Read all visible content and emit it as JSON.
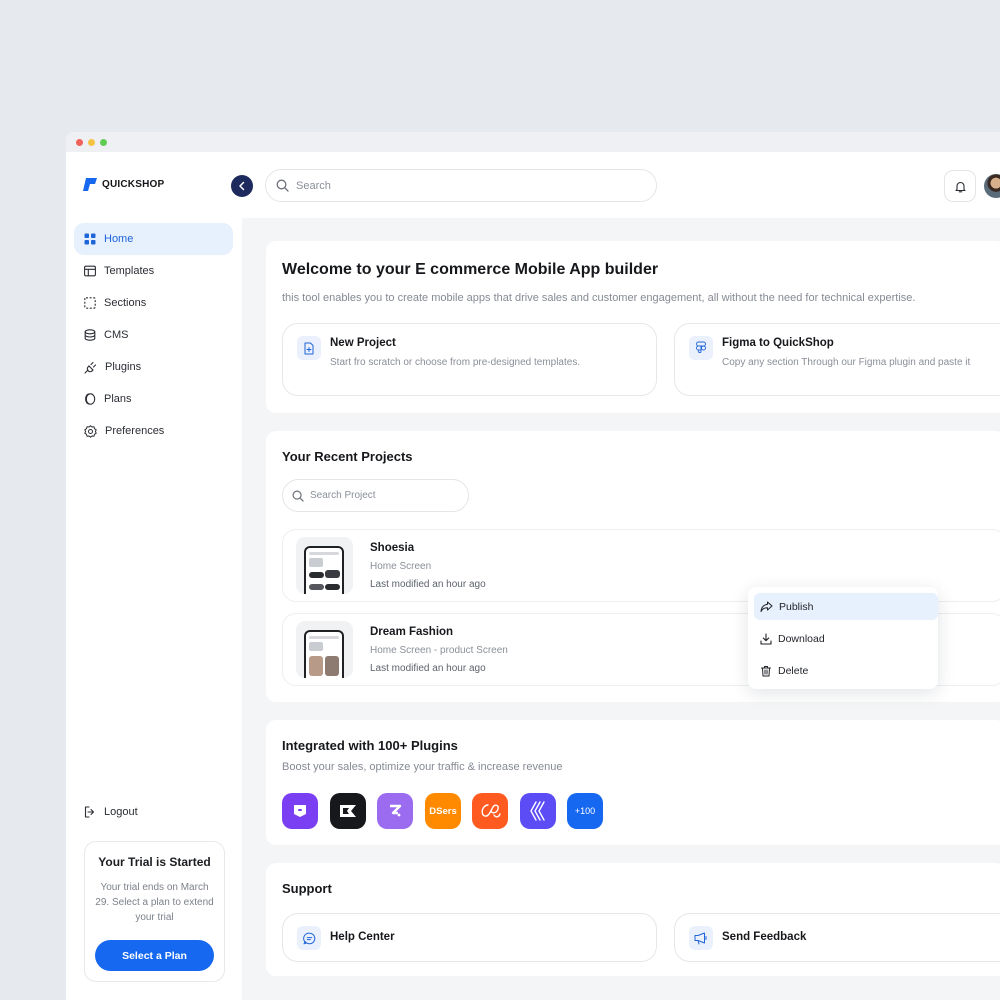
{
  "window": {
    "dots": [
      "#f0625b",
      "#f6c243",
      "#5fcb55"
    ]
  },
  "brand": {
    "name": "QUICKSHOP",
    "accent": "#1668f0"
  },
  "search": {
    "placeholder": "Search"
  },
  "sidebar": {
    "items": [
      {
        "label": "Home",
        "icon": "grid-icon",
        "active": true
      },
      {
        "label": "Templates",
        "icon": "layout-icon"
      },
      {
        "label": "Sections",
        "icon": "dashed-square-icon"
      },
      {
        "label": "CMS",
        "icon": "database-icon"
      },
      {
        "label": "Plugins",
        "icon": "plug-icon"
      },
      {
        "label": "Plans",
        "icon": "coin-icon"
      },
      {
        "label": "Preferences",
        "icon": "gear-icon"
      }
    ],
    "logout_label": "Logout",
    "trial": {
      "title": "Your Trial is Started",
      "text": "Your trial ends on March 29. Select a plan to extend your trial",
      "button_label": "Select a Plan"
    }
  },
  "welcome": {
    "title": "Welcome to your E commerce Mobile App builder",
    "subtitle": "this tool enables you to create mobile apps that drive sales and customer engagement, all without the need for technical expertise.",
    "actions": [
      {
        "title": "New Project",
        "desc": "Start fro scratch or choose from pre-designed templates.",
        "icon": "new-file-icon"
      },
      {
        "title": "Figma to QuickShop",
        "desc": "Copy any section Through our Figma plugin and paste it",
        "icon": "figma-icon"
      }
    ]
  },
  "recent": {
    "title": "Your Recent Projects",
    "search_placeholder": "Search Project",
    "projects": [
      {
        "name": "Shoesia",
        "screen": "Home Screen",
        "modified": "Last modified an hour ago"
      },
      {
        "name": "Dream Fashion",
        "screen": "Home Screen - product Screen",
        "modified": "Last modified an hour ago"
      }
    ]
  },
  "context_menu": {
    "items": [
      {
        "label": "Publish",
        "icon": "share-icon",
        "active": true
      },
      {
        "label": "Download",
        "icon": "download-icon"
      },
      {
        "label": "Delete",
        "icon": "trash-icon"
      }
    ]
  },
  "plugins": {
    "title": "Integrated with 100+ Plugins",
    "subtitle": "Boost your sales, optimize your traffic & increase revenue",
    "items": [
      {
        "name": "purple-tag-plugin-icon",
        "color": "#7a3ff2"
      },
      {
        "name": "black-k-plugin-icon",
        "color": "#17181b"
      },
      {
        "name": "violet-z-plugin-icon",
        "color": "#9b6cf0"
      },
      {
        "name": "dsers-plugin-icon",
        "color": "#ff8a00",
        "text": "DSers"
      },
      {
        "name": "orange-script-plugin-icon",
        "color": "#ff5a1f"
      },
      {
        "name": "chevrons-plugin-icon",
        "color": "#5b4cf5"
      },
      {
        "name": "more-plugins-badge",
        "color": "#1668f0",
        "text": "+100"
      }
    ]
  },
  "support": {
    "title": "Support",
    "items": [
      {
        "label": "Help Center",
        "icon": "chat-icon"
      },
      {
        "label": "Send Feedback",
        "icon": "megaphone-icon"
      }
    ]
  }
}
